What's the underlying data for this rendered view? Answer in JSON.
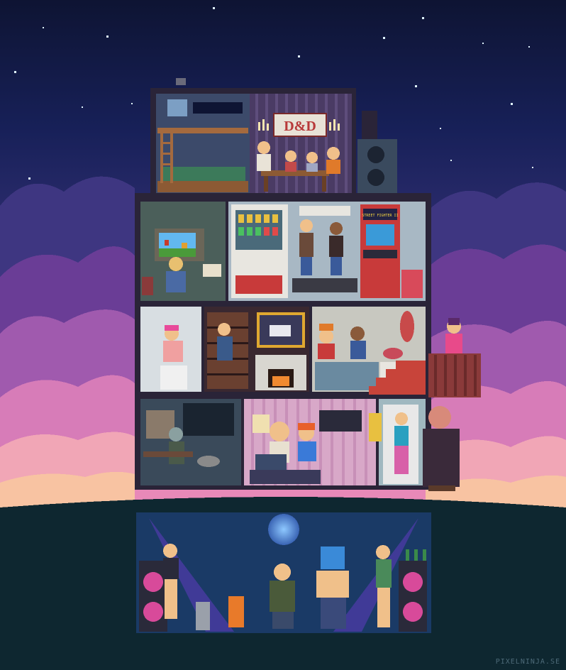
{
  "artwork": {
    "credit": "PIXELNINJA.SE"
  },
  "signs": {
    "dnd": "D&D",
    "arcade_marquee": "STREET FIGHTER II"
  },
  "rooms": [
    {
      "id": "attic-bedroom",
      "name": "Attic bedroom with bunk bed and D&D game night"
    },
    {
      "id": "gaming-room",
      "name": "Retro gaming room with CRT TV"
    },
    {
      "id": "arcade-gym",
      "name": "Vending machine, treadmills and arcade cabinet"
    },
    {
      "id": "bathroom",
      "name": "Bathroom"
    },
    {
      "id": "library",
      "name": "Library with fireplace and unicorn painting"
    },
    {
      "id": "kitchen",
      "name": "Kitchen with cooks and meat"
    },
    {
      "id": "office",
      "name": "Office with computer desk and cat"
    },
    {
      "id": "living-room",
      "name": "Living room watching TV"
    },
    {
      "id": "stairwell",
      "name": "Stairwell and entrance"
    },
    {
      "id": "balcony",
      "name": "Balcony"
    },
    {
      "id": "disco-basement",
      "name": "Disco basement dance party"
    }
  ],
  "colors": {
    "sky_top": "#0e1433",
    "sky_mid": "#2c2c6e",
    "cloud_purple": "#8a4aa6",
    "cloud_pink": "#e889b8",
    "cloud_peach": "#f6b79a",
    "ground": "#0e2730",
    "building_frame": "#2a2438",
    "disco_floor": "#1a3a66"
  }
}
